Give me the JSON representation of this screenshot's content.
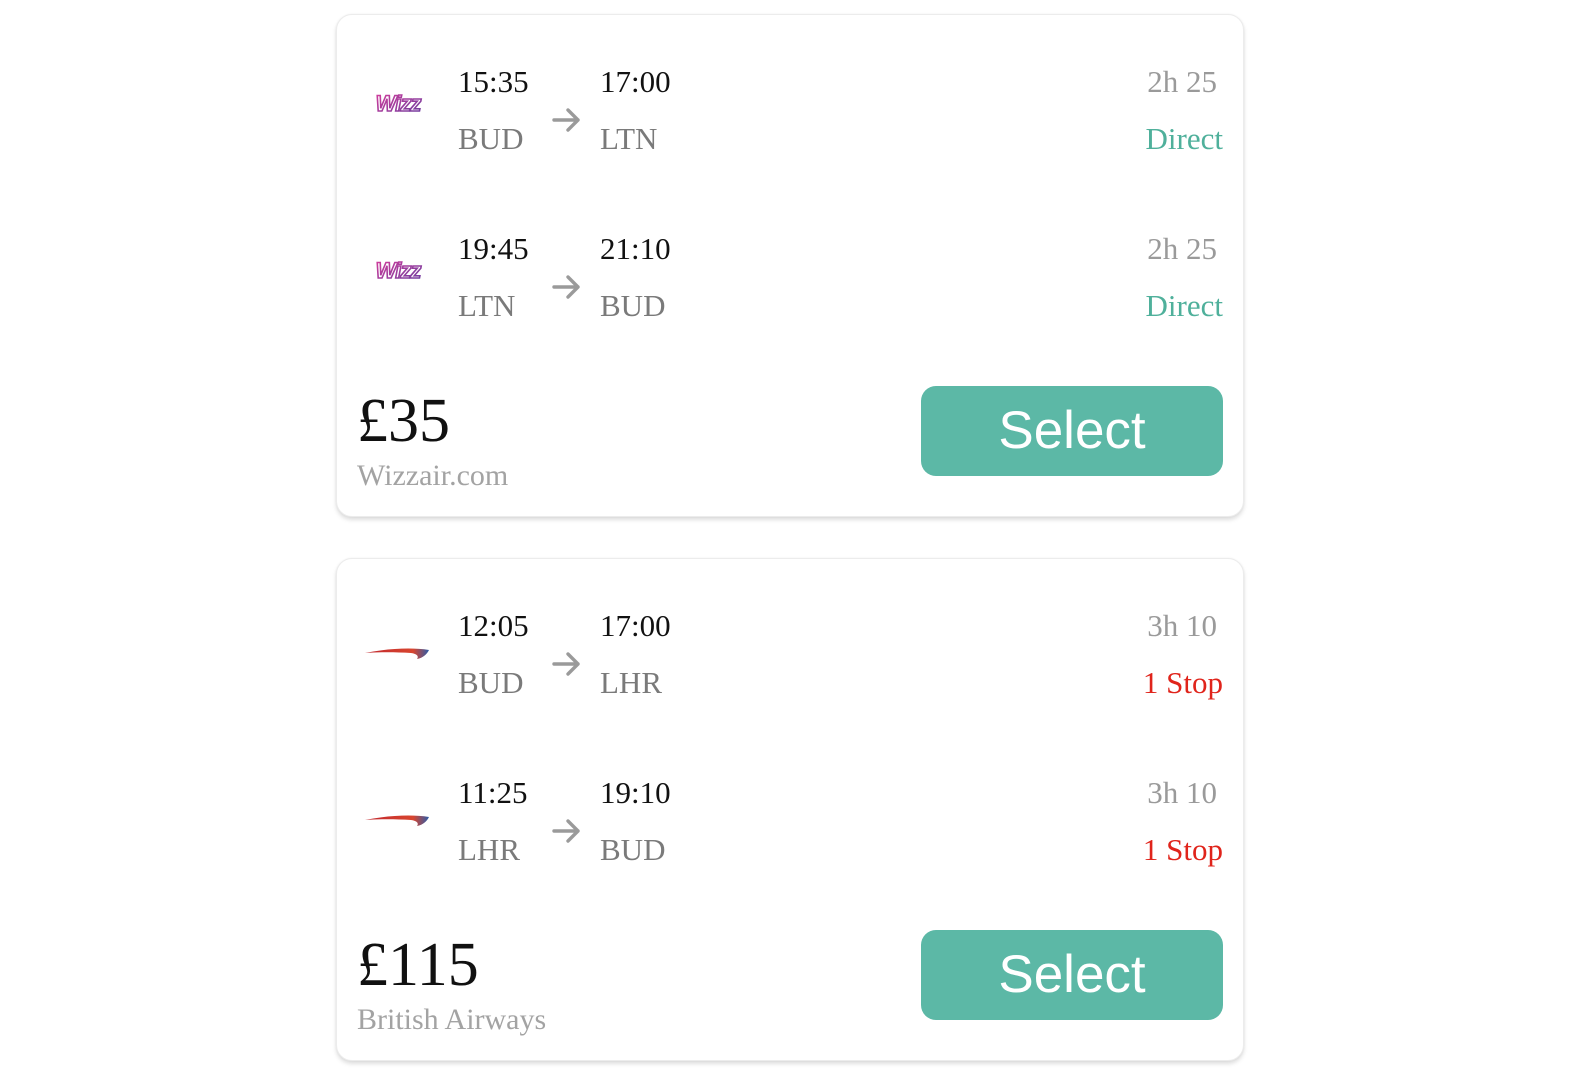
{
  "colors": {
    "accent": "#5cb8a6",
    "direct": "#4fb09b",
    "stop": "#e0241b",
    "muted": "#9a9a9a",
    "code": "#7a7a7a"
  },
  "results": [
    {
      "price": "£35",
      "provider": "Wizzair.com",
      "select_label": "Select",
      "legs": [
        {
          "airline_icon": "wizz-air-logo-icon",
          "dep_time": "15:35",
          "dep_code": "BUD",
          "arr_time": "17:00",
          "arr_code": "LTN",
          "duration": "2h 25",
          "stops": "Direct"
        },
        {
          "airline_icon": "wizz-air-logo-icon",
          "dep_time": "19:45",
          "dep_code": "LTN",
          "arr_time": "21:10",
          "arr_code": "BUD",
          "duration": "2h 25",
          "stops": "Direct"
        }
      ]
    },
    {
      "price": "£115",
      "provider": "British Airways",
      "select_label": "Select",
      "legs": [
        {
          "airline_icon": "british-airways-logo-icon",
          "dep_time": "12:05",
          "dep_code": "BUD",
          "arr_time": "17:00",
          "arr_code": "LHR",
          "duration": "3h 10",
          "stops": "1 Stop"
        },
        {
          "airline_icon": "british-airways-logo-icon",
          "dep_time": "11:25",
          "dep_code": "LHR",
          "arr_time": "19:10",
          "arr_code": "BUD",
          "duration": "3h 10",
          "stops": "1 Stop"
        }
      ]
    }
  ]
}
